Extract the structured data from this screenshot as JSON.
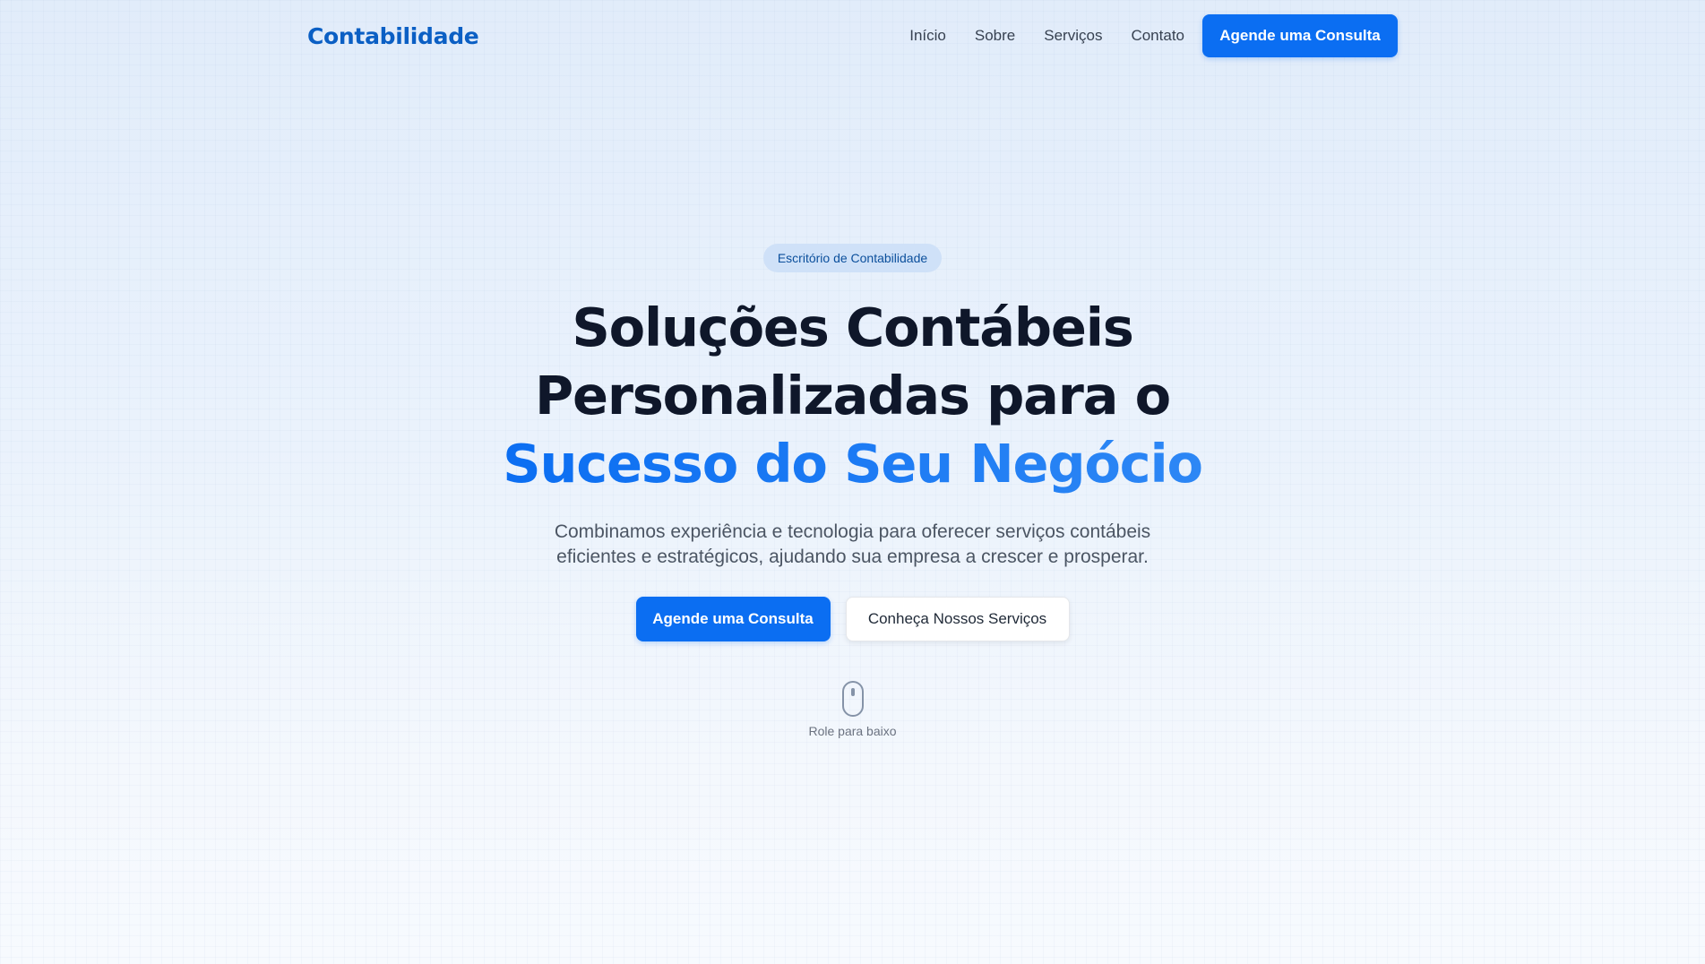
{
  "brand": {
    "name": "Contabilidade"
  },
  "nav": {
    "links": [
      "Início",
      "Sobre",
      "Serviços",
      "Contato"
    ],
    "cta_label": "Agende uma Consulta"
  },
  "hero": {
    "badge": "Escritório de Contabilidade",
    "headline_line1": "Soluções Contábeis",
    "headline_line2": "Personalizadas para o",
    "headline_accent": "Sucesso do Seu Negócio",
    "subtitle": "Combinamos experiência e tecnologia para oferecer serviços contábeis eficientes e estratégicos, ajudando sua empresa a crescer e prosperar.",
    "primary_button": "Agende uma Consulta",
    "secondary_button": "Conheça Nossos Serviços",
    "scroll_label": "Role para baixo",
    "scroll_icon": "mouse-icon"
  },
  "colors": {
    "brand": "#0b5fc4",
    "accent": "#0b6ef2",
    "badge_bg": "#cfe1f8",
    "heading": "#0f172a",
    "body_text": "#4b5563"
  }
}
